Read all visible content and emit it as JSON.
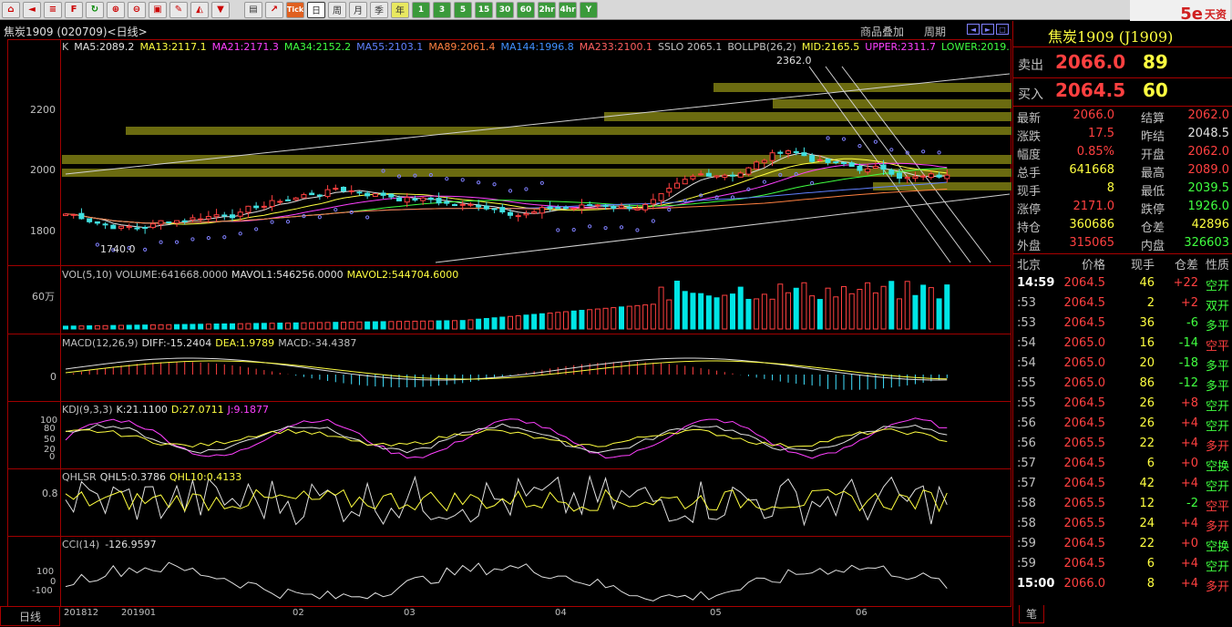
{
  "toolbar": {
    "icons": [
      "home-icon",
      "back-icon",
      "list-icon",
      "f10-icon",
      "refresh-icon",
      "zoom-in-icon",
      "zoom-out-icon",
      "window-icon",
      "draw-icon",
      "eraser-icon",
      "filter-icon",
      "table-icon",
      "chart-icon"
    ],
    "tick_label": "Tick",
    "periods": [
      "日",
      "周",
      "月",
      "季",
      "年"
    ],
    "active_period": "日",
    "minutes": [
      "1",
      "3",
      "5",
      "15",
      "30",
      "60",
      "2hr",
      "4hr",
      "Y"
    ]
  },
  "brand": {
    "logo": "5e",
    "name": "天资",
    "url_hint": "5e天资.com"
  },
  "window": {
    "title": "焦炭1909 (020709)<日线>",
    "btn_overlay": "商品叠加",
    "btn_period": "周期"
  },
  "main_chart": {
    "indicator_line": [
      {
        "text": "K",
        "color": "#c0c0c0"
      },
      {
        "text": "MA5:2089.2",
        "color": "#e0e0e0"
      },
      {
        "text": "MA13:2117.1",
        "color": "#ffff40"
      },
      {
        "text": "MA21:2171.3",
        "color": "#ff40ff"
      },
      {
        "text": "MA34:2152.2",
        "color": "#40ff40"
      },
      {
        "text": "MA55:2103.1",
        "color": "#6080ff"
      },
      {
        "text": "MA89:2061.4",
        "color": "#ff8040"
      },
      {
        "text": "MA144:1996.8",
        "color": "#4090ff"
      },
      {
        "text": "MA233:2100.1",
        "color": "#ff6060"
      },
      {
        "text": "SSLO 2065.1",
        "color": "#c0c0c0"
      },
      {
        "text": "BOLLPB(26,2)",
        "color": "#c0c0c0"
      },
      {
        "text": "MID:2165.5",
        "color": "#ffff40"
      },
      {
        "text": "UPPER:2311.7",
        "color": "#ff40ff"
      },
      {
        "text": "LOWER:2019.",
        "color": "#40ff40"
      }
    ],
    "y_labels": [
      "2200",
      "2000",
      "1800"
    ],
    "high_label": "2362.0",
    "low_label": "1740.0"
  },
  "vol": {
    "header": [
      {
        "text": "VOL(5,10) VOLUME:641668.0000",
        "color": "#c0c0c0"
      },
      {
        "text": "MAVOL1:546256.0000",
        "color": "#e0e0e0"
      },
      {
        "text": "MAVOL2:544704.6000",
        "color": "#ffff40"
      }
    ],
    "y_label": "60万"
  },
  "macd": {
    "header": [
      {
        "text": "MACD(12,26,9)",
        "color": "#c0c0c0"
      },
      {
        "text": "DIFF:-15.2404",
        "color": "#e0e0e0"
      },
      {
        "text": "DEA:1.9789",
        "color": "#ffff40"
      },
      {
        "text": "MACD:-34.4387",
        "color": "#c0c0c0"
      }
    ],
    "y_label": "0"
  },
  "kdj": {
    "header": [
      {
        "text": "KDJ(9,3,3)",
        "color": "#c0c0c0"
      },
      {
        "text": "K:21.1100",
        "color": "#e0e0e0"
      },
      {
        "text": "D:27.0711",
        "color": "#ffff40"
      },
      {
        "text": "J:9.1877",
        "color": "#ff40ff"
      }
    ],
    "y_labels": [
      "100",
      "80",
      "50",
      "20",
      "0"
    ]
  },
  "qhlsr": {
    "header": [
      {
        "text": "QHLSR",
        "color": "#c0c0c0"
      },
      {
        "text": "QHL5:0.3786",
        "color": "#e0e0e0"
      },
      {
        "text": "QHL10:0.4133",
        "color": "#ffff40"
      }
    ],
    "y_label": "0.8"
  },
  "cci": {
    "header": [
      {
        "text": "CCI(14)",
        "color": "#c0c0c0"
      },
      {
        "text": "-126.9597",
        "color": "#e0e0e0"
      }
    ],
    "y_labels": [
      "100",
      "0",
      "-100"
    ]
  },
  "x_axis": {
    "period_label": "日线",
    "labels": [
      "201812",
      "201901",
      "02",
      "03",
      "04",
      "05",
      "06"
    ]
  },
  "quote": {
    "title": "焦炭1909 (J1909)",
    "sell_label": "卖出",
    "sell_price": "2066.0",
    "sell_vol": "89",
    "buy_label": "买入",
    "buy_price": "2064.5",
    "buy_vol": "60",
    "rows": [
      {
        "l1": "最新",
        "v1": "2066.0",
        "c1": "#ff4040",
        "l2": "结算",
        "v2": "2062.0",
        "c2": "#ff4040"
      },
      {
        "l1": "涨跌",
        "v1": "17.5",
        "c1": "#ff4040",
        "l2": "昨结",
        "v2": "2048.5",
        "c2": "#e0e0e0"
      },
      {
        "l1": "幅度",
        "v1": "0.85%",
        "c1": "#ff4040",
        "l2": "开盘",
        "v2": "2062.0",
        "c2": "#ff4040"
      },
      {
        "l1": "总手",
        "v1": "641668",
        "c1": "#ffff40",
        "l2": "最高",
        "v2": "2089.0",
        "c2": "#ff4040"
      },
      {
        "l1": "现手",
        "v1": "8",
        "c1": "#ffff40",
        "l2": "最低",
        "v2": "2039.5",
        "c2": "#40ff40"
      },
      {
        "l1": "涨停",
        "v1": "2171.0",
        "c1": "#ff4040",
        "l2": "跌停",
        "v2": "1926.0",
        "c2": "#40ff40"
      },
      {
        "l1": "持仓",
        "v1": "360686",
        "c1": "#ffff40",
        "l2": "仓差",
        "v2": "42896",
        "c2": "#ffff40"
      },
      {
        "l1": "外盘",
        "v1": "315065",
        "c1": "#ff4040",
        "l2": "内盘",
        "v2": "326603",
        "c2": "#40ff40"
      }
    ],
    "tick_headers": [
      "北京",
      "价格",
      "现手",
      "仓差",
      "性质"
    ],
    "ticks": [
      {
        "t": "14:59",
        "p": "2064.5",
        "v": "46",
        "d": "+22",
        "n": "空开",
        "nc": "#40ff40"
      },
      {
        "t": ":53",
        "p": "2064.5",
        "v": "2",
        "d": "+2",
        "n": "双开",
        "nc": "#40ff40"
      },
      {
        "t": ":53",
        "p": "2064.5",
        "v": "36",
        "d": "-6",
        "n": "多平",
        "nc": "#40ff40"
      },
      {
        "t": ":54",
        "p": "2065.0",
        "v": "16",
        "d": "-14",
        "n": "空平",
        "nc": "#ff4040"
      },
      {
        "t": ":54",
        "p": "2065.0",
        "v": "20",
        "d": "-18",
        "n": "多平",
        "nc": "#40ff40"
      },
      {
        "t": ":55",
        "p": "2065.0",
        "v": "86",
        "d": "-12",
        "n": "多平",
        "nc": "#40ff40"
      },
      {
        "t": ":55",
        "p": "2064.5",
        "v": "26",
        "d": "+8",
        "n": "空开",
        "nc": "#40ff40"
      },
      {
        "t": ":56",
        "p": "2064.5",
        "v": "26",
        "d": "+4",
        "n": "空开",
        "nc": "#40ff40"
      },
      {
        "t": ":56",
        "p": "2065.5",
        "v": "22",
        "d": "+4",
        "n": "多开",
        "nc": "#ff4040"
      },
      {
        "t": ":57",
        "p": "2064.5",
        "v": "6",
        "d": "+0",
        "n": "空换",
        "nc": "#40ff40"
      },
      {
        "t": ":57",
        "p": "2064.5",
        "v": "42",
        "d": "+4",
        "n": "空开",
        "nc": "#40ff40"
      },
      {
        "t": ":58",
        "p": "2065.5",
        "v": "12",
        "d": "-2",
        "n": "空平",
        "nc": "#ff4040"
      },
      {
        "t": ":58",
        "p": "2065.5",
        "v": "24",
        "d": "+4",
        "n": "多开",
        "nc": "#ff4040"
      },
      {
        "t": ":59",
        "p": "2064.5",
        "v": "22",
        "d": "+0",
        "n": "空换",
        "nc": "#40ff40"
      },
      {
        "t": ":59",
        "p": "2064.5",
        "v": "6",
        "d": "+4",
        "n": "空开",
        "nc": "#40ff40"
      },
      {
        "t": "15:00",
        "p": "2066.0",
        "v": "8",
        "d": "+4",
        "n": "多开",
        "nc": "#ff4040"
      }
    ],
    "bottom_tab": "笔"
  }
}
